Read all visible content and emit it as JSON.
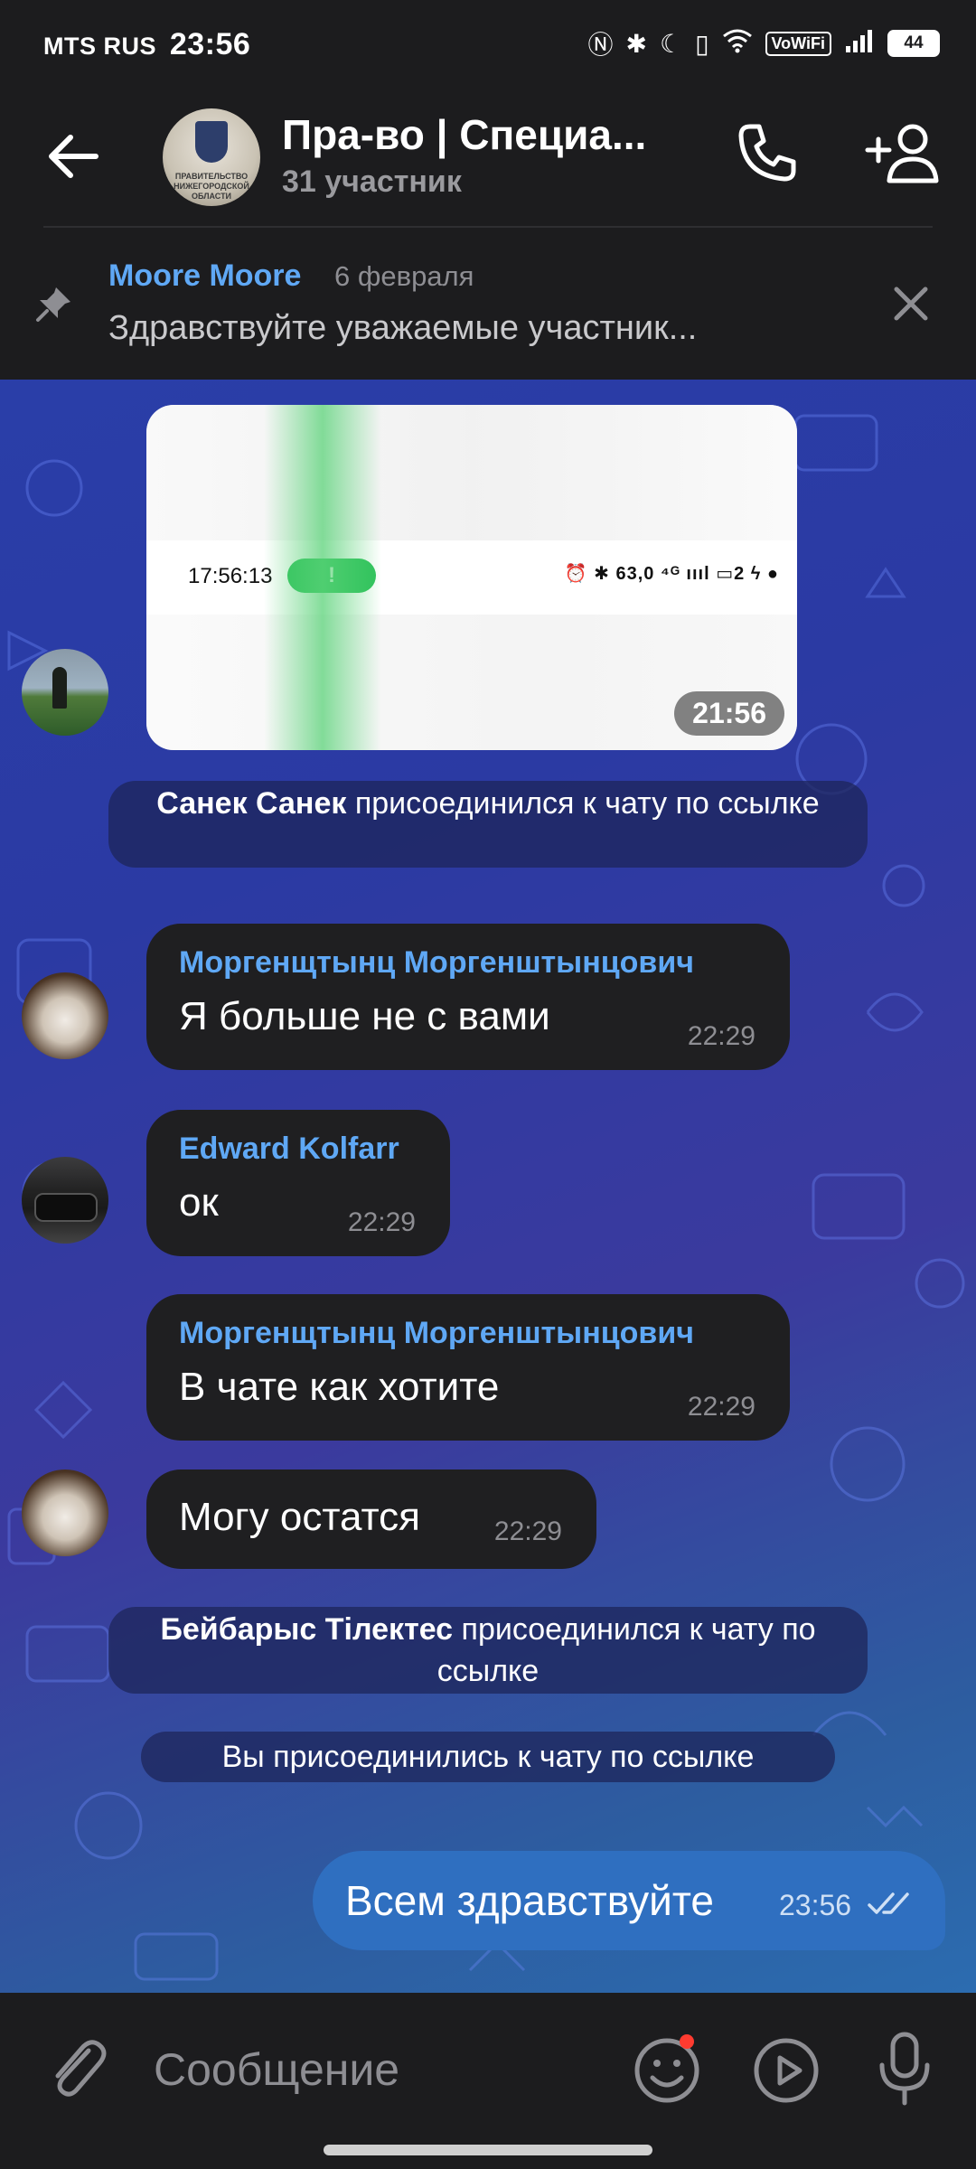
{
  "status_bar": {
    "carrier": "MTS RUS",
    "time": "23:56",
    "vowifi": "VoWiFi",
    "battery": "44"
  },
  "header": {
    "title": "Пра-во | Специа...",
    "subtitle": "31 участник",
    "avatar_text": "ПРАВИТЕЛЬСТВО НИЖЕГОРОДСКОЙ ОБЛАСТИ"
  },
  "pinned": {
    "author": "Moore Moore",
    "date": "6 февраля",
    "text": "Здравствуйте уважаемые участник..."
  },
  "photo_message": {
    "strip_time": "17:56:13",
    "strip_pill": "!",
    "strip_icons": "⏰ ✱ 63,0 ⁴ᴳ ıııl ▭2 ϟ ●",
    "time": "21:56"
  },
  "service_1": {
    "name": "Санек Санек",
    "text": " присоединился к чату по ссылке"
  },
  "messages": [
    {
      "name": "Моргенщтынц Моргенштынцович",
      "text": "Я больше не с вами",
      "time": "22:29"
    },
    {
      "name": "Edward Kolfarr",
      "text": "ок",
      "time": "22:29"
    },
    {
      "name": "Моргенщтынц Моргенштынцович",
      "text": "В чате как хотите",
      "time": "22:29"
    },
    {
      "text": "Могу остатся",
      "time": "22:29"
    }
  ],
  "service_2": {
    "name": "Бейбарыс Тілектес",
    "text": " присоединился к чату по ссылке"
  },
  "service_3": {
    "text": "Вы присоединились к чату по ссылке"
  },
  "outgoing": {
    "text": "Всем здравствуйте",
    "time": "23:56"
  },
  "composer": {
    "placeholder": "Сообщение"
  },
  "colors": {
    "accent_name": "#5fa8f5",
    "bubble_out": "#2f6fc0",
    "bubble_in": "#1f1f21"
  }
}
